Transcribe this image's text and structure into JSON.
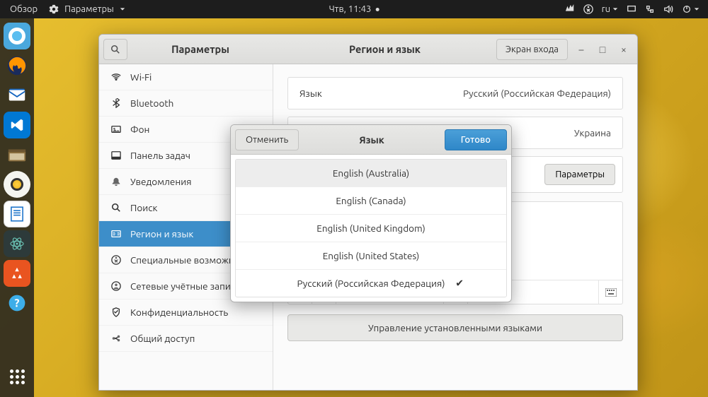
{
  "topbar": {
    "overview": "Обзор",
    "current_app": "Параметры",
    "clock": "Чтв, 11:43",
    "lang_indicator": "ru"
  },
  "dock": {
    "items": [
      "chromium",
      "firefox",
      "thunderbird",
      "vscode",
      "files",
      "rhythmbox",
      "writer",
      "atom",
      "software",
      "help"
    ]
  },
  "window": {
    "search_placeholder": "Поиск",
    "title_left": "Параметры",
    "title_right": "Регион и язык",
    "login_screen_btn": "Экран входа"
  },
  "sidebar": {
    "items": [
      {
        "icon": "wifi",
        "label": "Wi-Fi"
      },
      {
        "icon": "bluetooth",
        "label": "Bluetooth"
      },
      {
        "icon": "background",
        "label": "Фон"
      },
      {
        "icon": "dock",
        "label": "Панель задач"
      },
      {
        "icon": "notifications",
        "label": "Уведомления"
      },
      {
        "icon": "search",
        "label": "Поиск"
      },
      {
        "icon": "region",
        "label": "Регион и язык"
      },
      {
        "icon": "accessibility",
        "label": "Специальные возможности"
      },
      {
        "icon": "accounts",
        "label": "Сетевые учётные записи"
      },
      {
        "icon": "privacy",
        "label": "Конфиденциальность"
      },
      {
        "icon": "sharing",
        "label": "Общий доступ"
      }
    ],
    "active_index": 6
  },
  "content": {
    "rows": [
      {
        "label": "Язык",
        "value": "Русский (Российская Федерация)"
      },
      {
        "label": "",
        "value": "Украина"
      }
    ],
    "params_btn": "Параметры",
    "manage_btn": "Управление установленными языками"
  },
  "dialog": {
    "cancel": "Отменить",
    "title": "Язык",
    "done": "Готово",
    "languages": [
      {
        "label": "English (Australia)",
        "selected": true
      },
      {
        "label": "English (Canada)",
        "selected": false
      },
      {
        "label": "English (United Kingdom)",
        "selected": false
      },
      {
        "label": "English (United States)",
        "selected": false
      },
      {
        "label": "Русский (Российская Федерация)",
        "selected": false,
        "checked": true
      }
    ]
  }
}
